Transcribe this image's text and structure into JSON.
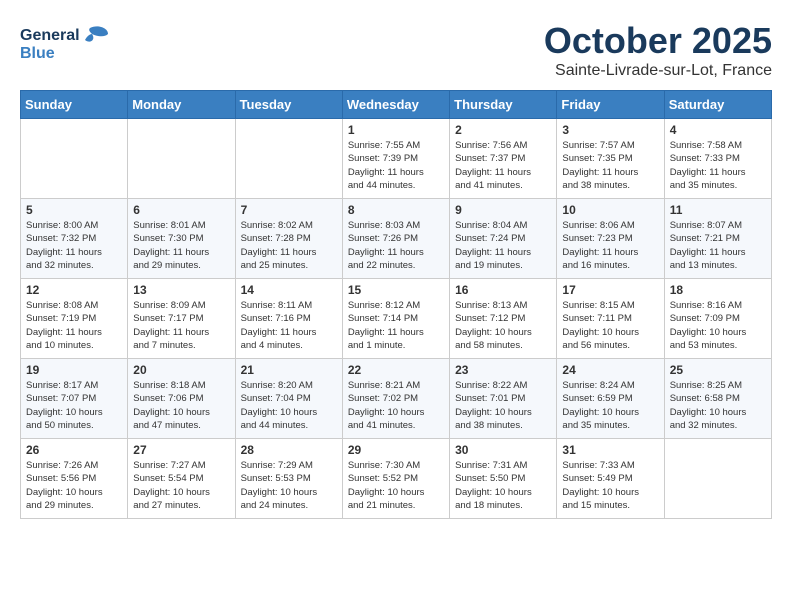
{
  "header": {
    "logo_general": "General",
    "logo_blue": "Blue",
    "month_title": "October 2025",
    "location": "Sainte-Livrade-sur-Lot, France"
  },
  "weekdays": [
    "Sunday",
    "Monday",
    "Tuesday",
    "Wednesday",
    "Thursday",
    "Friday",
    "Saturday"
  ],
  "weeks": [
    [
      {
        "day": "",
        "info": ""
      },
      {
        "day": "",
        "info": ""
      },
      {
        "day": "",
        "info": ""
      },
      {
        "day": "1",
        "info": "Sunrise: 7:55 AM\nSunset: 7:39 PM\nDaylight: 11 hours\nand 44 minutes."
      },
      {
        "day": "2",
        "info": "Sunrise: 7:56 AM\nSunset: 7:37 PM\nDaylight: 11 hours\nand 41 minutes."
      },
      {
        "day": "3",
        "info": "Sunrise: 7:57 AM\nSunset: 7:35 PM\nDaylight: 11 hours\nand 38 minutes."
      },
      {
        "day": "4",
        "info": "Sunrise: 7:58 AM\nSunset: 7:33 PM\nDaylight: 11 hours\nand 35 minutes."
      }
    ],
    [
      {
        "day": "5",
        "info": "Sunrise: 8:00 AM\nSunset: 7:32 PM\nDaylight: 11 hours\nand 32 minutes."
      },
      {
        "day": "6",
        "info": "Sunrise: 8:01 AM\nSunset: 7:30 PM\nDaylight: 11 hours\nand 29 minutes."
      },
      {
        "day": "7",
        "info": "Sunrise: 8:02 AM\nSunset: 7:28 PM\nDaylight: 11 hours\nand 25 minutes."
      },
      {
        "day": "8",
        "info": "Sunrise: 8:03 AM\nSunset: 7:26 PM\nDaylight: 11 hours\nand 22 minutes."
      },
      {
        "day": "9",
        "info": "Sunrise: 8:04 AM\nSunset: 7:24 PM\nDaylight: 11 hours\nand 19 minutes."
      },
      {
        "day": "10",
        "info": "Sunrise: 8:06 AM\nSunset: 7:23 PM\nDaylight: 11 hours\nand 16 minutes."
      },
      {
        "day": "11",
        "info": "Sunrise: 8:07 AM\nSunset: 7:21 PM\nDaylight: 11 hours\nand 13 minutes."
      }
    ],
    [
      {
        "day": "12",
        "info": "Sunrise: 8:08 AM\nSunset: 7:19 PM\nDaylight: 11 hours\nand 10 minutes."
      },
      {
        "day": "13",
        "info": "Sunrise: 8:09 AM\nSunset: 7:17 PM\nDaylight: 11 hours\nand 7 minutes."
      },
      {
        "day": "14",
        "info": "Sunrise: 8:11 AM\nSunset: 7:16 PM\nDaylight: 11 hours\nand 4 minutes."
      },
      {
        "day": "15",
        "info": "Sunrise: 8:12 AM\nSunset: 7:14 PM\nDaylight: 11 hours\nand 1 minute."
      },
      {
        "day": "16",
        "info": "Sunrise: 8:13 AM\nSunset: 7:12 PM\nDaylight: 10 hours\nand 58 minutes."
      },
      {
        "day": "17",
        "info": "Sunrise: 8:15 AM\nSunset: 7:11 PM\nDaylight: 10 hours\nand 56 minutes."
      },
      {
        "day": "18",
        "info": "Sunrise: 8:16 AM\nSunset: 7:09 PM\nDaylight: 10 hours\nand 53 minutes."
      }
    ],
    [
      {
        "day": "19",
        "info": "Sunrise: 8:17 AM\nSunset: 7:07 PM\nDaylight: 10 hours\nand 50 minutes."
      },
      {
        "day": "20",
        "info": "Sunrise: 8:18 AM\nSunset: 7:06 PM\nDaylight: 10 hours\nand 47 minutes."
      },
      {
        "day": "21",
        "info": "Sunrise: 8:20 AM\nSunset: 7:04 PM\nDaylight: 10 hours\nand 44 minutes."
      },
      {
        "day": "22",
        "info": "Sunrise: 8:21 AM\nSunset: 7:02 PM\nDaylight: 10 hours\nand 41 minutes."
      },
      {
        "day": "23",
        "info": "Sunrise: 8:22 AM\nSunset: 7:01 PM\nDaylight: 10 hours\nand 38 minutes."
      },
      {
        "day": "24",
        "info": "Sunrise: 8:24 AM\nSunset: 6:59 PM\nDaylight: 10 hours\nand 35 minutes."
      },
      {
        "day": "25",
        "info": "Sunrise: 8:25 AM\nSunset: 6:58 PM\nDaylight: 10 hours\nand 32 minutes."
      }
    ],
    [
      {
        "day": "26",
        "info": "Sunrise: 7:26 AM\nSunset: 5:56 PM\nDaylight: 10 hours\nand 29 minutes."
      },
      {
        "day": "27",
        "info": "Sunrise: 7:27 AM\nSunset: 5:54 PM\nDaylight: 10 hours\nand 27 minutes."
      },
      {
        "day": "28",
        "info": "Sunrise: 7:29 AM\nSunset: 5:53 PM\nDaylight: 10 hours\nand 24 minutes."
      },
      {
        "day": "29",
        "info": "Sunrise: 7:30 AM\nSunset: 5:52 PM\nDaylight: 10 hours\nand 21 minutes."
      },
      {
        "day": "30",
        "info": "Sunrise: 7:31 AM\nSunset: 5:50 PM\nDaylight: 10 hours\nand 18 minutes."
      },
      {
        "day": "31",
        "info": "Sunrise: 7:33 AM\nSunset: 5:49 PM\nDaylight: 10 hours\nand 15 minutes."
      },
      {
        "day": "",
        "info": ""
      }
    ]
  ]
}
